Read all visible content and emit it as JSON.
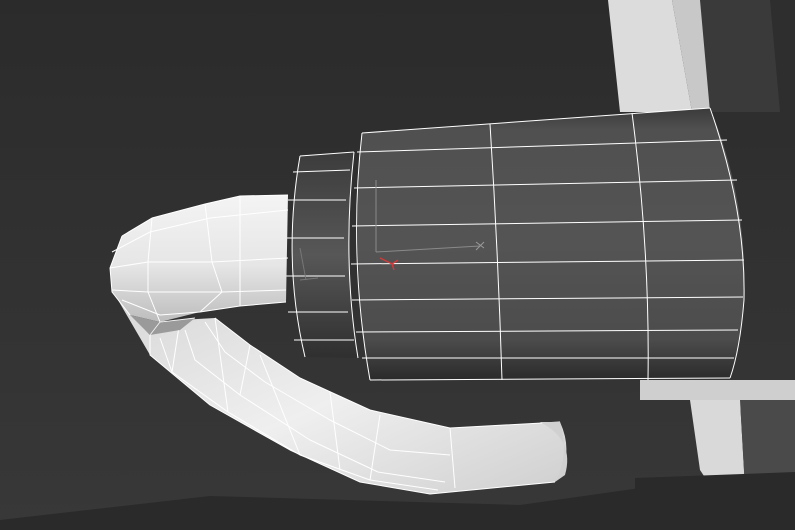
{
  "viewport": {
    "background": "#2f2f2f",
    "mesh_color": "#ffffff",
    "gizmo_axis_color": "#8a8a8a",
    "gizmo_marker_color": "#d23a3a"
  },
  "objects": [
    "background-walls",
    "cylinder-body",
    "cylinder-collar",
    "hose-upper",
    "hose-lower",
    "transform-gizmo"
  ],
  "icons": [
    "axis-gizmo-icon",
    "pivot-marker-icon"
  ]
}
